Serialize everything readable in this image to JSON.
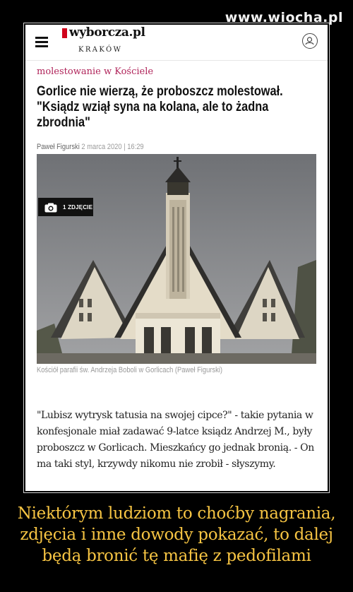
{
  "watermark": "www.wiocha.pl",
  "header": {
    "logo": "wyborcza.pl",
    "city": "KRAKÓW"
  },
  "article": {
    "category": "molestowanie w Kościele",
    "headline": "Gorlice nie wierzą, że proboszcz molestował. \"Ksiądz wziął syna na kolana, ale to żadna zbrodnia\"",
    "author": "Paweł Figurski",
    "date": "2 marca 2020 | 16:29",
    "photo_badge": "1 ZDJĘCIE",
    "caption": "Kościół parafii św. Andrzeja Boboli w Gorlicach (Paweł Figurski)",
    "body": "\"Lubisz wytrysk tatusia na swojej cipce?\" - takie pytania w konfesjonale miał zadawać 9-latce ksiądz Andrzej M., były proboszcz w Gorlicach. Mieszkańcy go jednak bronią. - On ma taki styl, krzywdy nikomu nie zrobił - słyszymy."
  },
  "bottom_caption": "Niektórym ludziom to choćby nagrania, zdjęcia i inne dowody pokazać, to dalej będą bronić tę mafię z pedofilami",
  "colors": {
    "background": "#000000",
    "category": "#b0245a",
    "logo_mark": "#d0021b",
    "bottom_caption": "#f6c443"
  }
}
